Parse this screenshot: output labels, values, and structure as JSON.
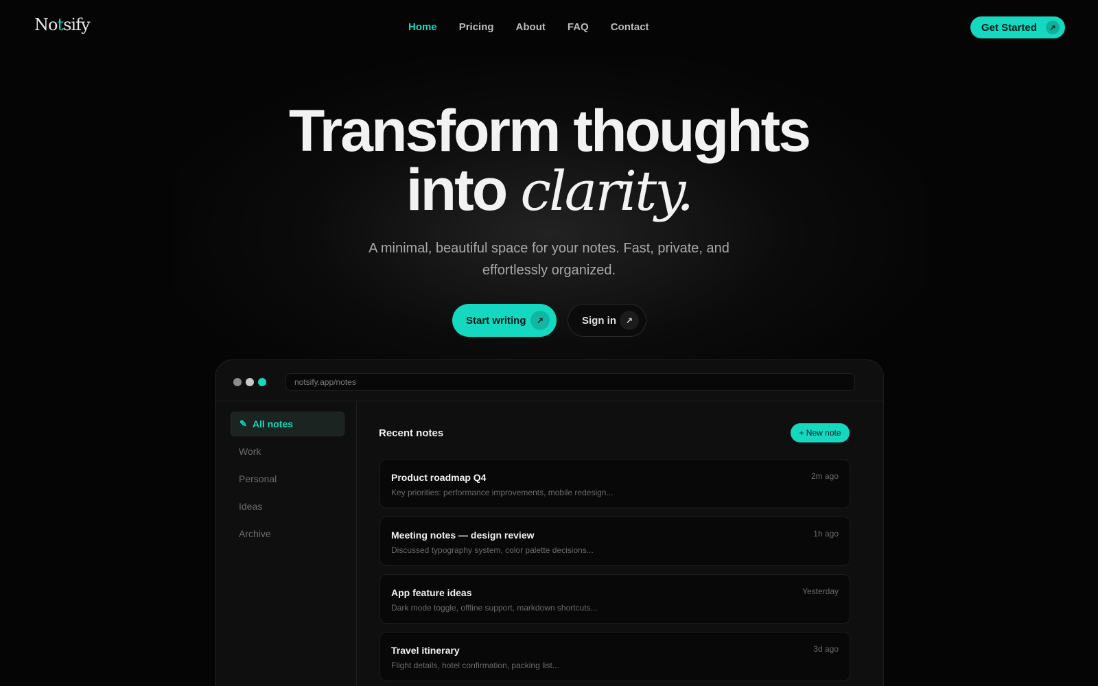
{
  "brand": {
    "logo_prefix": "No",
    "logo_accent": "t",
    "logo_suffix": "sify",
    "accent_color": "#14d8bf"
  },
  "nav": {
    "links": [
      {
        "label": "Home",
        "active": true
      },
      {
        "label": "Pricing"
      },
      {
        "label": "About"
      },
      {
        "label": "FAQ"
      },
      {
        "label": "Contact"
      }
    ],
    "cta_label": "Get Started",
    "cta_icon": "arrow-up-right-icon"
  },
  "hero": {
    "title_line1": "Transform thoughts",
    "title_line2_plain": "into",
    "title_line2_italic": "clarity.",
    "subtitle": "A minimal, beautiful space for your notes. Fast, private, and effortlessly organized.",
    "primary_cta": "Start writing",
    "secondary_cta": "Sign in"
  },
  "app": {
    "url": "notsify.app/notes",
    "sidebar": [
      {
        "label": "All notes",
        "active": true,
        "icon": "pencil-icon"
      },
      {
        "label": "Work"
      },
      {
        "label": "Personal"
      },
      {
        "label": "Ideas"
      },
      {
        "label": "Archive"
      }
    ],
    "recent_title": "Recent notes",
    "new_note_label": "+ New note",
    "notes": [
      {
        "title": "Product roadmap Q4",
        "snippet": "Key priorities: performance improvements, mobile redesign...",
        "time": "2m ago"
      },
      {
        "title": "Meeting notes — design review",
        "snippet": "Discussed typography system, color palette decisions...",
        "time": "1h ago"
      },
      {
        "title": "App feature ideas",
        "snippet": "Dark mode toggle, offline support, markdown shortcuts...",
        "time": "Yesterday"
      },
      {
        "title": "Travel itinerary",
        "snippet": "Flight details, hotel confirmation, packing list...",
        "time": "3d ago"
      }
    ]
  }
}
